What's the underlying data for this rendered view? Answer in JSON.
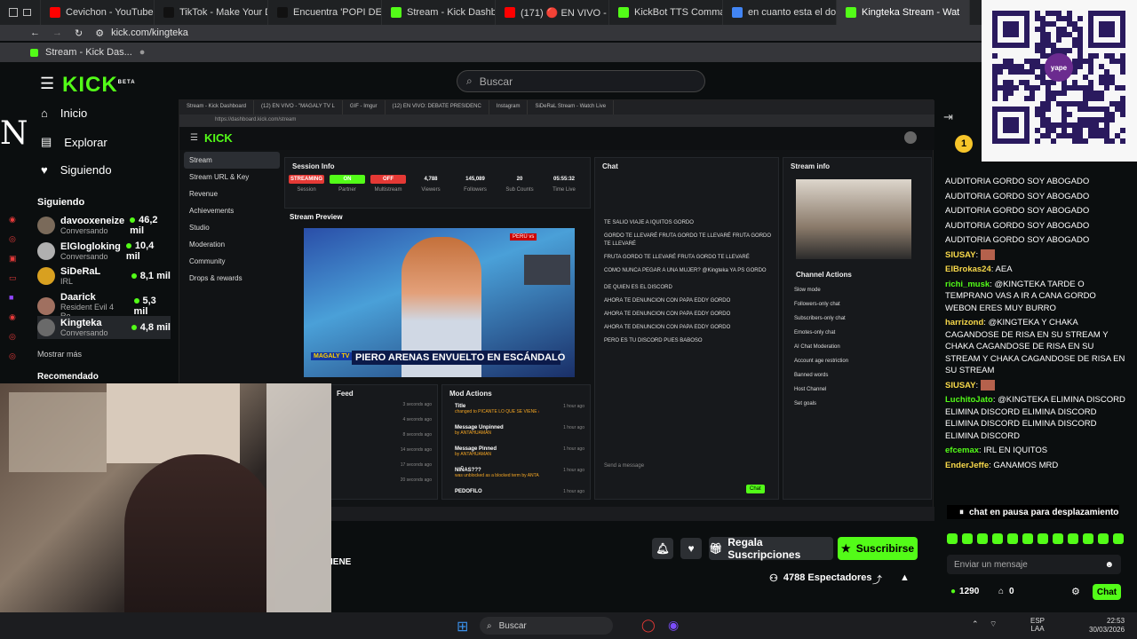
{
  "browser": {
    "tabs": [
      {
        "label": "Cevichon - YouTube",
        "color": "#ff0000"
      },
      {
        "label": "TikTok - Make Your Day",
        "color": "#111111"
      },
      {
        "label": "Encuentra 'POPI DEBATE'",
        "color": "#111111"
      },
      {
        "label": "Stream - Kick Dashboard",
        "color": "#53fc18"
      },
      {
        "label": "(171) 🔴 EN VIVO - \"MAG",
        "color": "#ff0000"
      },
      {
        "label": "KickBot TTS Commands",
        "color": "#53fc18"
      },
      {
        "label": "en cuanto esta el dolar - E",
        "color": "#4285f4"
      },
      {
        "label": "Kingteka Stream - Wat",
        "color": "#53fc18"
      }
    ],
    "url": "kick.com/kingteka",
    "bookmark": "Stream - Kick Das..."
  },
  "kick": {
    "logo": "KICK",
    "beta": "BETA",
    "search_placeholder": "Buscar",
    "nav": [
      "Inicio",
      "Explorar",
      "Siguiendo"
    ],
    "following_header": "Siguiendo",
    "following": [
      {
        "name": "davooxeneize",
        "game": "Conversando",
        "viewers": "46,2 mil",
        "color": "#7a6a5a"
      },
      {
        "name": "ElGlogloking",
        "game": "Conversando",
        "viewers": "10,4 mil",
        "color": "#b0b0b0"
      },
      {
        "name": "SiDeRaL",
        "game": "IRL",
        "viewers": "8,1 mil",
        "color": "#d8a020"
      },
      {
        "name": "Daarick",
        "game": "Resident Evil 4 Re...",
        "viewers": "5,3 mil",
        "color": "#a07060"
      },
      {
        "name": "Kingteka",
        "game": "Conversando",
        "viewers": "4,8 mil",
        "color": "#6a6a6a"
      }
    ],
    "show_more": "Mostrar más",
    "recommended": "Recomendado"
  },
  "inner": {
    "tabs": [
      "Stream - Kick Dashboard",
      "(12) EN VIVO - \"MAGALY TV L",
      "GIF - Imgur",
      "(12) EN VIVO: DEBATE PRESIDENC",
      "Instagram",
      "SiDeRaL Stream - Watch Live"
    ],
    "url": "https://dashboard.kick.com/stream",
    "sidebar": [
      "Stream",
      "Stream URL & Key",
      "Revenue",
      "Achievements",
      "Studio",
      "Moderation",
      "Community",
      "Drops & rewards"
    ],
    "session_info": "Session Info",
    "stats": [
      {
        "value": "STREAMING",
        "label": "Session"
      },
      {
        "value": "ON",
        "label": "Partner"
      },
      {
        "value": "OFF",
        "label": "Multistream"
      },
      {
        "value": "4,788",
        "label": "Viewers"
      },
      {
        "value": "145,089",
        "label": "Followers"
      },
      {
        "value": "20",
        "label": "Sub Counts"
      },
      {
        "value": "05:55:32",
        "label": "Time Live"
      }
    ],
    "stream_preview": "Stream Preview",
    "headline": "PIERO ARENAS ENVUELTO EN ESCÁNDALO",
    "channel_brand": "MAGALY TV",
    "feed": "Feed",
    "mod_actions": "Mod Actions",
    "mod_items": [
      {
        "title": "Title",
        "sub": "changed to PICANTE LO QUE SE VIENE 🔥 by Kingteka",
        "time": "1 hour ago"
      },
      {
        "title": "Message Unpinned",
        "sub": "by ANTAHUAMAN",
        "time": "1 hour ago"
      },
      {
        "title": "Message Pinned",
        "sub": "by ANTAHUAMAN",
        "time": "1 hour ago"
      },
      {
        "title": "NIÑAS???",
        "sub": "was unblocked as a blocked term by ANTAHUAMAN",
        "time": "1 hour ago"
      },
      {
        "title": "PEDOFILO",
        "sub": "",
        "time": "1 hour ago"
      }
    ],
    "feed_times": [
      "3 seconds ago",
      "4 seconds ago",
      "8 seconds ago",
      "14 seconds ago",
      "17 seconds ago",
      "20 seconds ago"
    ],
    "chat": "Chat",
    "chat_lines": [
      "TE SALIO VIAJE A IQUITOS GORDO",
      "GORDO TE LLEVARÉ FRUTA GORDO TE LLEVARÉ FRUTA GORDO TE LLEVARÉ",
      "FRUTA GORDO TE LLEVARÉ FRUTA GORDO TE LLEVARÉ",
      "COMO NUNCA PEGAR A UNA MUJER? @Kingteka YA PS GORDO",
      "DE QUIEN ES EL DISCORD",
      "AHORA TE DENUNCION CON PAPA EDDY GORDO",
      "AHORA TE DENUNCION CON PAPA EDDY GORDO",
      "AHORA TE DENUNCION CON PAPA EDDY GORDO",
      "PERO ES TU DISCORD PUES BABOSO"
    ],
    "send_placeholder": "Send a message",
    "chat_button": "Chat",
    "stream_info": "Stream info",
    "channel_actions": "Channel Actions",
    "actions": [
      "Slow mode",
      "Followers-only chat",
      "Subscribers-only chat",
      "Emotes-only chat",
      "AI Chat Moderation",
      "Account age restriction",
      "Banned words",
      "Host Channel",
      "Set goals"
    ]
  },
  "chat": {
    "messages": [
      {
        "user": "",
        "text": "AUDITORIA GORDO SOY ABOGADO"
      },
      {
        "user": "",
        "text": "AUDITORIA GORDO SOY ABOGADO"
      },
      {
        "user": "",
        "text": "AUDITORIA GORDO SOY ABOGADO"
      },
      {
        "user": "",
        "text": "AUDITORIA GORDO SOY ABOGADO"
      },
      {
        "user": "",
        "text": "AUDITORIA GORDO SOY ABOGADO"
      },
      {
        "user": "SIUSAY",
        "text": "",
        "ucolor": "#f7d84a"
      },
      {
        "user": "ElBrokas24",
        "text": "AEA",
        "ucolor": "#f7d84a"
      },
      {
        "user": "richi_musk",
        "text": "@KINGTEKA TARDE O TEMPRANO VAS A IR A CANA GORDO WEBON ERES MUY BURRO",
        "ucolor": "#53fc18"
      },
      {
        "user": "harrizond",
        "text": "@KINGTEKA Y CHAKA CAGANDOSE DE RISA EN SU STREAM Y CHAKA CAGANDOSE DE RISA EN SU STREAM Y CHAKA CAGANDOSE DE RISA EN SU STREAM",
        "ucolor": "#f7d84a"
      },
      {
        "user": "SIUSAY",
        "text": "",
        "ucolor": "#f7d84a"
      },
      {
        "user": "LuchitoJato",
        "text": "@KINGTEKA ELIMINA DISCORD ELIMINA DISCORD ELIMINA DISCORD ELIMINA DISCORD ELIMINA DISCORD ELIMINA DISCORD",
        "ucolor": "#53fc18"
      },
      {
        "user": "efcemax",
        "text": "IRL EN IQUITOS",
        "ucolor": "#53fc18"
      },
      {
        "user": "EnderJeffe",
        "text": "GANAMOS MRD",
        "ucolor": "#f7d84a"
      }
    ],
    "paused": "chat en pausa para desplazamiento",
    "input_placeholder": "Enviar un mensaje",
    "points": "1290",
    "count": "0",
    "chat_button": "Chat"
  },
  "actions": {
    "gift_subs": "Regala Suscripciones",
    "subscribe": "Suscribirse",
    "viewers": "4788 Espectadores",
    "title_fragment": "IENE"
  },
  "taskbar": {
    "search": "Buscar",
    "lang": "ESP",
    "region": "LAA",
    "time": "22:53",
    "date": "30/03/2026"
  },
  "colors": {
    "accent": "#53fc18",
    "bg": "#0b0e0f"
  }
}
